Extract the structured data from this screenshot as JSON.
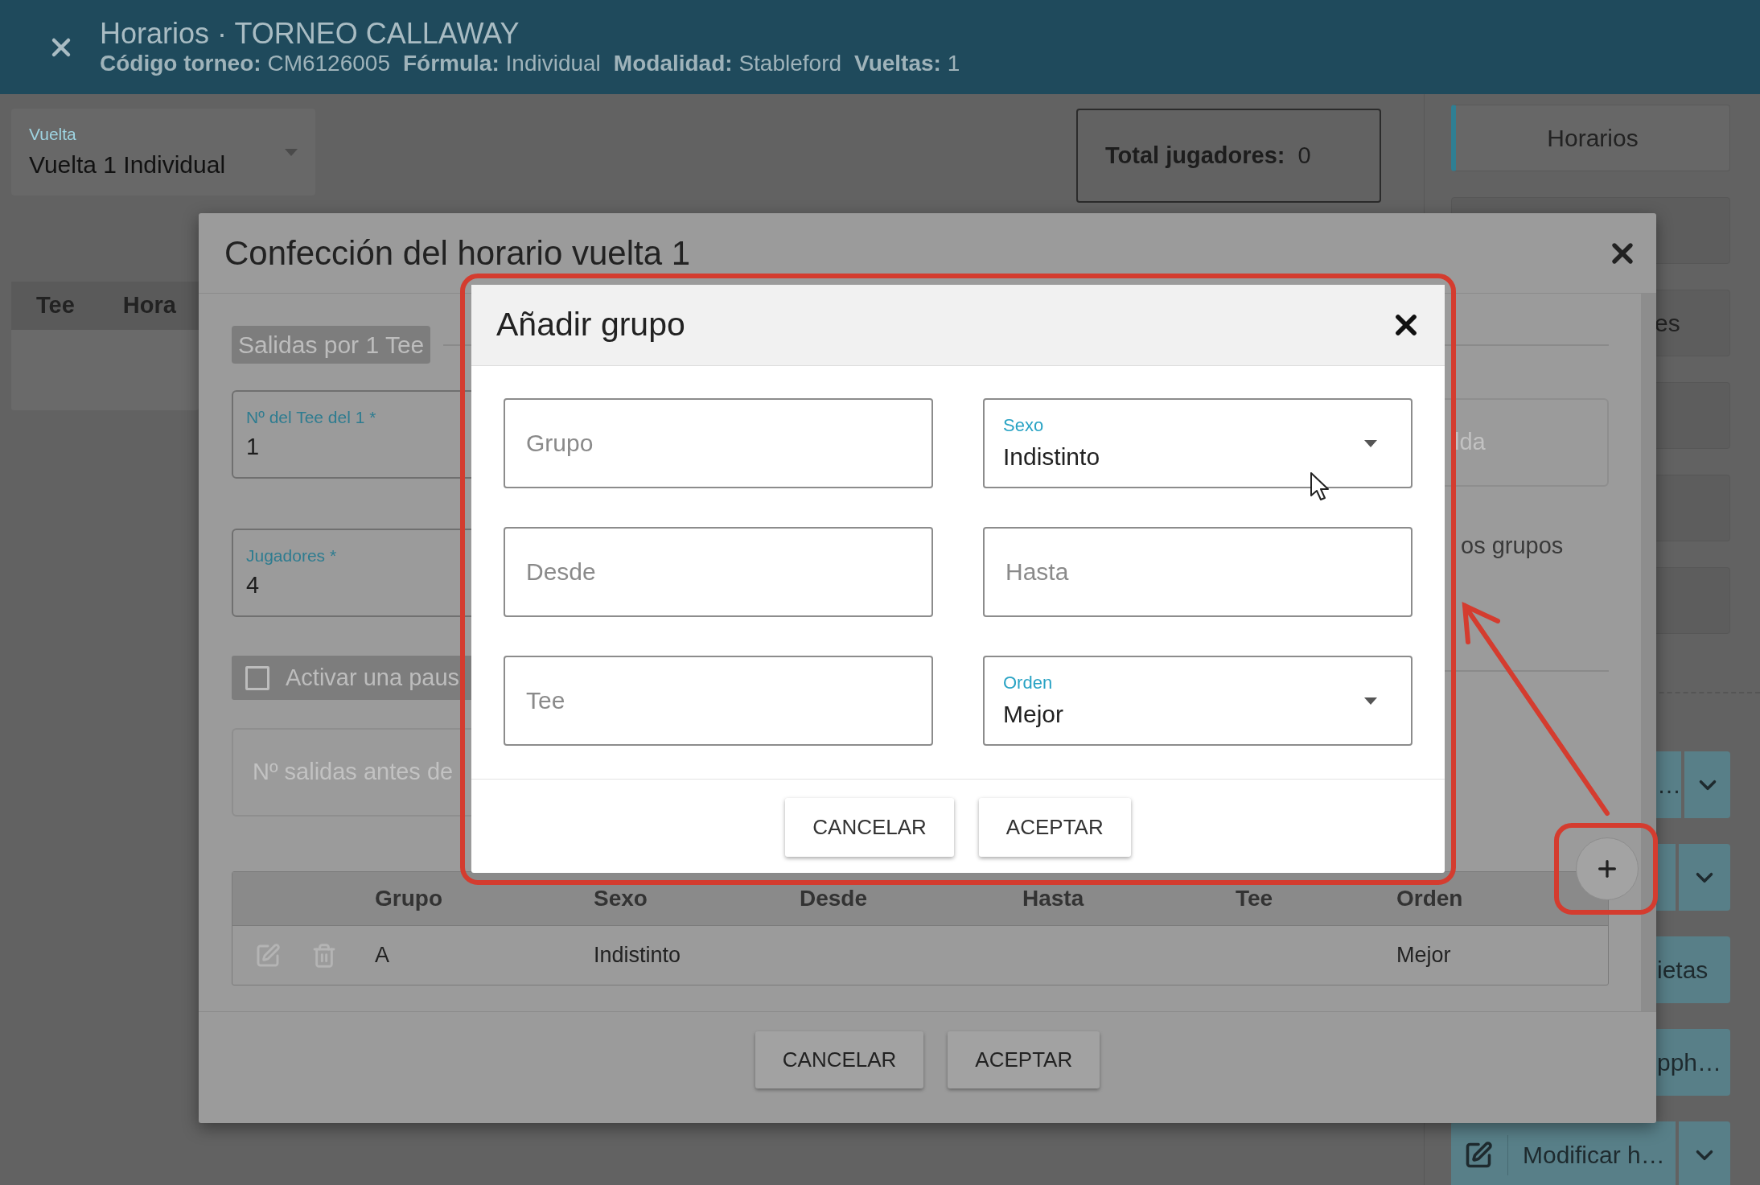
{
  "header": {
    "title": "Horarios · TORNEO CALLAWAY",
    "details": [
      {
        "label": "Código torneo:",
        "value": "CM6126005"
      },
      {
        "label": "Fórmula:",
        "value": "Individual"
      },
      {
        "label": "Modalidad:",
        "value": "Stableford"
      },
      {
        "label": "Vueltas:",
        "value": "1"
      }
    ]
  },
  "round_select": {
    "label": "Vuelta",
    "value": "Vuelta 1 Individual"
  },
  "total_players": {
    "label": "Total jugadores:",
    "value": "0"
  },
  "schedule_table": {
    "columns": [
      "Tee",
      "Hora"
    ]
  },
  "sidebar": {
    "items": [
      {
        "kind": "tab",
        "label": "Horarios",
        "selected": true
      },
      {
        "kind": "gray"
      },
      {
        "kind": "gray",
        "label": "es"
      },
      {
        "kind": "gray"
      },
      {
        "kind": "gray"
      },
      {
        "kind": "gray"
      },
      {
        "kind": "divider"
      },
      {
        "kind": "teal-menu",
        "label": "…"
      },
      {
        "kind": "teal-menu"
      },
      {
        "kind": "teal",
        "label": "ietas"
      },
      {
        "kind": "teal",
        "label": "pph…"
      },
      {
        "kind": "edit-menu",
        "label": "Modificar h…",
        "selected": false
      }
    ]
  },
  "schedule_dialog": {
    "title": "Confección del horario vuelta 1",
    "mode_chip": "Salidas por 1 Tee",
    "fields": [
      {
        "label": "Nº del Tee del 1 *",
        "value": "1"
      },
      {
        "label": "Jugadores *",
        "value": "4"
      }
    ],
    "pause": {
      "label": "Activar una paus",
      "checked": false
    },
    "pause_field": {
      "placeholder": "Nº salidas antes de"
    },
    "side_field": {
      "placeholder": "lda"
    },
    "side_text": "os grupos",
    "groups_table": {
      "columns": [
        "Grupo",
        "Sexo",
        "Desde",
        "Hasta",
        "Tee",
        "Orden"
      ],
      "rows": [
        {
          "cells": [
            "A",
            "Indistinto",
            null,
            null,
            null,
            "Mejor"
          ]
        }
      ]
    },
    "buttons": [
      "CANCELAR",
      "ACEPTAR"
    ]
  },
  "add_group_dialog": {
    "title": "Añadir grupo",
    "fields": [
      {
        "kind": "text",
        "placeholder": "Grupo"
      },
      {
        "kind": "text",
        "placeholder": "Desde"
      },
      {
        "kind": "text",
        "placeholder": "Tee"
      },
      {
        "kind": "select",
        "label": "Sexo",
        "value": "Indistinto"
      },
      {
        "kind": "text",
        "placeholder": "Hasta"
      },
      {
        "kind": "select",
        "label": "Orden",
        "value": "Mejor"
      }
    ],
    "buttons": [
      "CANCELAR",
      "ACEPTAR"
    ]
  }
}
